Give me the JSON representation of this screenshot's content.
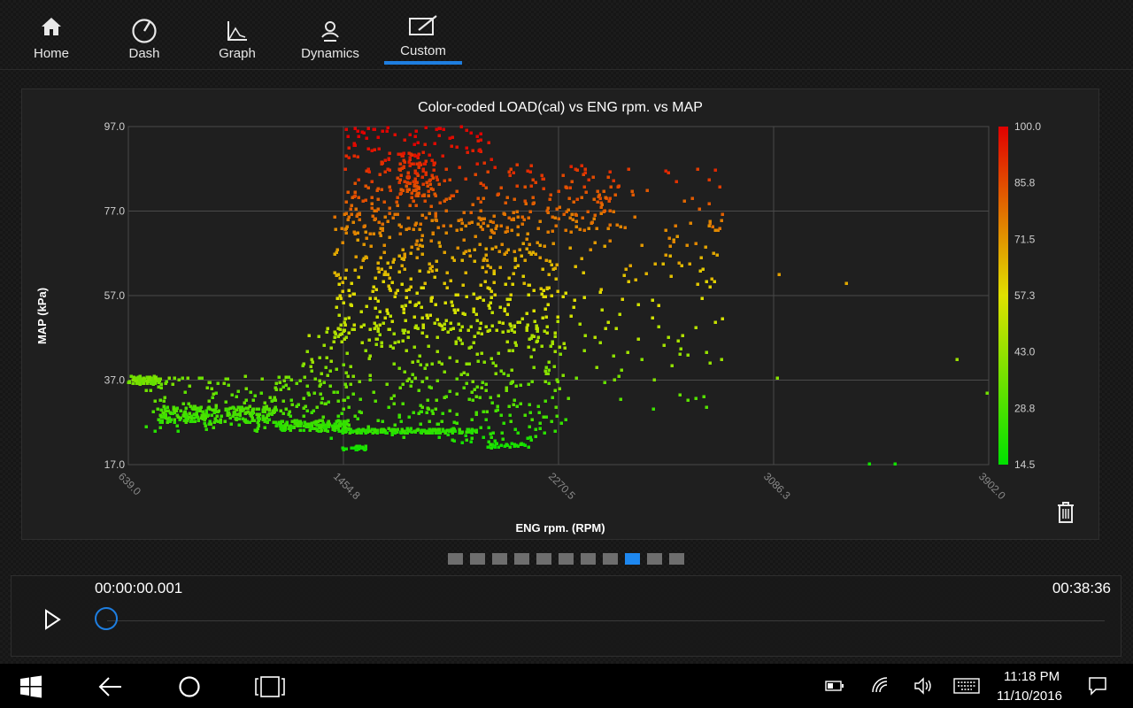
{
  "nav": {
    "items": [
      {
        "label": "Home",
        "icon": "home-icon"
      },
      {
        "label": "Dash",
        "icon": "gauge-icon"
      },
      {
        "label": "Graph",
        "icon": "graph-icon"
      },
      {
        "label": "Dynamics",
        "icon": "dynamics-icon"
      },
      {
        "label": "Custom",
        "icon": "custom-icon",
        "active": true
      }
    ],
    "accent_color": "#1e7ee0"
  },
  "chart": {
    "title": "Color-coded LOAD(cal) vs ENG rpm. vs MAP",
    "xlabel": "ENG rpm. (RPM)",
    "ylabel": "MAP (kPa)"
  },
  "chart_data": {
    "type": "scatter",
    "title": "Color-coded LOAD(cal) vs ENG rpm. vs MAP",
    "xlabel": "ENG rpm. (RPM)",
    "ylabel": "MAP (kPa)",
    "xlim": [
      639.0,
      3902.0
    ],
    "ylim": [
      17.0,
      97.0
    ],
    "x_ticks": [
      "639.0",
      "1454.8",
      "2270.5",
      "3086.3",
      "3902.0"
    ],
    "y_ticks": [
      "97.0",
      "77.0",
      "57.0",
      "37.0",
      "17.0"
    ],
    "colorbar": {
      "label_ticks": [
        "100.0",
        "85.8",
        "71.5",
        "57.3",
        "43.0",
        "28.8",
        "14.5"
      ],
      "range": [
        14.5,
        100.0
      ],
      "colors": [
        "#00e000",
        "#e0e000",
        "#e00000"
      ]
    },
    "grid": true,
    "clusters": [
      {
        "x": [
          640,
          760
        ],
        "y": [
          36,
          38
        ],
        "n": 70
      },
      {
        "x": [
          760,
          1200
        ],
        "y": [
          27,
          31
        ],
        "n": 220
      },
      {
        "x": [
          1200,
          1480
        ],
        "y": [
          25,
          27.5
        ],
        "n": 140
      },
      {
        "x": [
          1450,
          1960
        ],
        "y": [
          24.5,
          25.5
        ],
        "n": 170
      },
      {
        "x": [
          1450,
          1550
        ],
        "y": [
          20.5,
          21.5
        ],
        "n": 30
      },
      {
        "x": [
          2000,
          2160
        ],
        "y": [
          21,
          22
        ],
        "n": 25
      },
      {
        "x": [
          700,
          1400
        ],
        "y": [
          25,
          38
        ],
        "n": 160
      },
      {
        "x": [
          1300,
          2300
        ],
        "y": [
          22,
          50
        ],
        "n": 380
      },
      {
        "x": [
          1420,
          2270
        ],
        "y": [
          48,
          77
        ],
        "n": 420
      },
      {
        "x": [
          1460,
          2480
        ],
        "y": [
          72,
          88
        ],
        "n": 220
      },
      {
        "x": [
          1660,
          1800
        ],
        "y": [
          80,
          91
        ],
        "n": 90
      },
      {
        "x": [
          1460,
          2020
        ],
        "y": [
          88,
          97
        ],
        "n": 80
      },
      {
        "x": [
          2270,
          2900
        ],
        "y": [
          60,
          88
        ],
        "n": 90
      },
      {
        "x": [
          2270,
          2900
        ],
        "y": [
          30,
          60
        ],
        "n": 60
      }
    ],
    "points": [
      {
        "x": 3100,
        "y": 37.5,
        "v": 40
      },
      {
        "x": 3105,
        "y": 62,
        "v": 70
      },
      {
        "x": 3360,
        "y": 60,
        "v": 68
      },
      {
        "x": 3450,
        "y": 17.2,
        "v": 18
      },
      {
        "x": 3545,
        "y": 17.2,
        "v": 18
      },
      {
        "x": 3780,
        "y": 42,
        "v": 44
      },
      {
        "x": 3895,
        "y": 34,
        "v": 36
      },
      {
        "x": 2880,
        "y": 73,
        "v": 78
      }
    ]
  },
  "pager": {
    "count": 11,
    "active": 8
  },
  "playback": {
    "start_time": "00:00:00.001",
    "end_time": "00:38:36",
    "progress": 0.0
  },
  "taskbar": {
    "time": "11:18 PM",
    "date": "11/10/2016"
  }
}
